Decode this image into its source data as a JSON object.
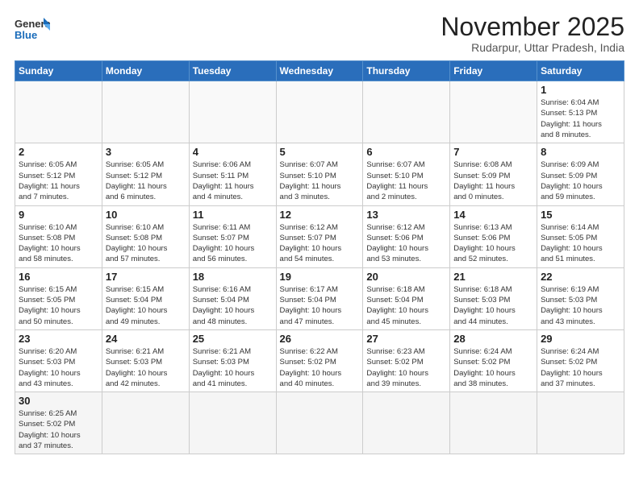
{
  "header": {
    "logo_line1": "General",
    "logo_line2": "Blue",
    "title": "November 2025",
    "subtitle": "Rudarpur, Uttar Pradesh, India"
  },
  "weekdays": [
    "Sunday",
    "Monday",
    "Tuesday",
    "Wednesday",
    "Thursday",
    "Friday",
    "Saturday"
  ],
  "weeks": [
    [
      {
        "day": "",
        "info": ""
      },
      {
        "day": "",
        "info": ""
      },
      {
        "day": "",
        "info": ""
      },
      {
        "day": "",
        "info": ""
      },
      {
        "day": "",
        "info": ""
      },
      {
        "day": "",
        "info": ""
      },
      {
        "day": "1",
        "info": "Sunrise: 6:04 AM\nSunset: 5:13 PM\nDaylight: 11 hours\nand 8 minutes."
      }
    ],
    [
      {
        "day": "2",
        "info": "Sunrise: 6:05 AM\nSunset: 5:12 PM\nDaylight: 11 hours\nand 7 minutes."
      },
      {
        "day": "3",
        "info": "Sunrise: 6:05 AM\nSunset: 5:12 PM\nDaylight: 11 hours\nand 6 minutes."
      },
      {
        "day": "4",
        "info": "Sunrise: 6:06 AM\nSunset: 5:11 PM\nDaylight: 11 hours\nand 4 minutes."
      },
      {
        "day": "5",
        "info": "Sunrise: 6:07 AM\nSunset: 5:10 PM\nDaylight: 11 hours\nand 3 minutes."
      },
      {
        "day": "6",
        "info": "Sunrise: 6:07 AM\nSunset: 5:10 PM\nDaylight: 11 hours\nand 2 minutes."
      },
      {
        "day": "7",
        "info": "Sunrise: 6:08 AM\nSunset: 5:09 PM\nDaylight: 11 hours\nand 0 minutes."
      },
      {
        "day": "8",
        "info": "Sunrise: 6:09 AM\nSunset: 5:09 PM\nDaylight: 10 hours\nand 59 minutes."
      }
    ],
    [
      {
        "day": "9",
        "info": "Sunrise: 6:10 AM\nSunset: 5:08 PM\nDaylight: 10 hours\nand 58 minutes."
      },
      {
        "day": "10",
        "info": "Sunrise: 6:10 AM\nSunset: 5:08 PM\nDaylight: 10 hours\nand 57 minutes."
      },
      {
        "day": "11",
        "info": "Sunrise: 6:11 AM\nSunset: 5:07 PM\nDaylight: 10 hours\nand 56 minutes."
      },
      {
        "day": "12",
        "info": "Sunrise: 6:12 AM\nSunset: 5:07 PM\nDaylight: 10 hours\nand 54 minutes."
      },
      {
        "day": "13",
        "info": "Sunrise: 6:12 AM\nSunset: 5:06 PM\nDaylight: 10 hours\nand 53 minutes."
      },
      {
        "day": "14",
        "info": "Sunrise: 6:13 AM\nSunset: 5:06 PM\nDaylight: 10 hours\nand 52 minutes."
      },
      {
        "day": "15",
        "info": "Sunrise: 6:14 AM\nSunset: 5:05 PM\nDaylight: 10 hours\nand 51 minutes."
      }
    ],
    [
      {
        "day": "16",
        "info": "Sunrise: 6:15 AM\nSunset: 5:05 PM\nDaylight: 10 hours\nand 50 minutes."
      },
      {
        "day": "17",
        "info": "Sunrise: 6:15 AM\nSunset: 5:04 PM\nDaylight: 10 hours\nand 49 minutes."
      },
      {
        "day": "18",
        "info": "Sunrise: 6:16 AM\nSunset: 5:04 PM\nDaylight: 10 hours\nand 48 minutes."
      },
      {
        "day": "19",
        "info": "Sunrise: 6:17 AM\nSunset: 5:04 PM\nDaylight: 10 hours\nand 47 minutes."
      },
      {
        "day": "20",
        "info": "Sunrise: 6:18 AM\nSunset: 5:04 PM\nDaylight: 10 hours\nand 45 minutes."
      },
      {
        "day": "21",
        "info": "Sunrise: 6:18 AM\nSunset: 5:03 PM\nDaylight: 10 hours\nand 44 minutes."
      },
      {
        "day": "22",
        "info": "Sunrise: 6:19 AM\nSunset: 5:03 PM\nDaylight: 10 hours\nand 43 minutes."
      }
    ],
    [
      {
        "day": "23",
        "info": "Sunrise: 6:20 AM\nSunset: 5:03 PM\nDaylight: 10 hours\nand 43 minutes."
      },
      {
        "day": "24",
        "info": "Sunrise: 6:21 AM\nSunset: 5:03 PM\nDaylight: 10 hours\nand 42 minutes."
      },
      {
        "day": "25",
        "info": "Sunrise: 6:21 AM\nSunset: 5:03 PM\nDaylight: 10 hours\nand 41 minutes."
      },
      {
        "day": "26",
        "info": "Sunrise: 6:22 AM\nSunset: 5:02 PM\nDaylight: 10 hours\nand 40 minutes."
      },
      {
        "day": "27",
        "info": "Sunrise: 6:23 AM\nSunset: 5:02 PM\nDaylight: 10 hours\nand 39 minutes."
      },
      {
        "day": "28",
        "info": "Sunrise: 6:24 AM\nSunset: 5:02 PM\nDaylight: 10 hours\nand 38 minutes."
      },
      {
        "day": "29",
        "info": "Sunrise: 6:24 AM\nSunset: 5:02 PM\nDaylight: 10 hours\nand 37 minutes."
      }
    ],
    [
      {
        "day": "30",
        "info": "Sunrise: 6:25 AM\nSunset: 5:02 PM\nDaylight: 10 hours\nand 37 minutes."
      },
      {
        "day": "",
        "info": ""
      },
      {
        "day": "",
        "info": ""
      },
      {
        "day": "",
        "info": ""
      },
      {
        "day": "",
        "info": ""
      },
      {
        "day": "",
        "info": ""
      },
      {
        "day": "",
        "info": ""
      }
    ]
  ]
}
